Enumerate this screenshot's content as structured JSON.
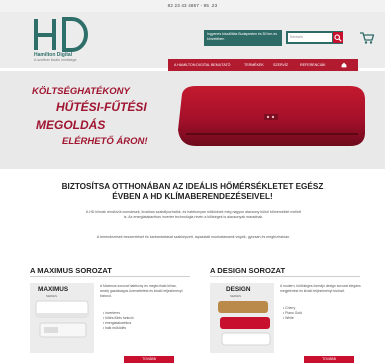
{
  "topbar": {
    "phone": "82 23 43 4867 - 85 .23"
  },
  "logo": {
    "mark": "HD",
    "name": "Hamilton Digital",
    "tagline": "A szoftver kiváló minősége"
  },
  "promo": {
    "text": "Ingyenes kiszállítás Budapesten és 50 km-es körzetében"
  },
  "search": {
    "placeholder": "Keresés"
  },
  "nav": {
    "items": [
      "A HAMILTON DIGITAL BEMUTATÓ",
      "TERMÉKEK",
      "SZERVÍZ",
      "REFERENCIÁK"
    ]
  },
  "banner": {
    "line1": "Költséghatékony",
    "line2": "hűtési-fűtési",
    "line3": "megoldás",
    "line4": "elérhető áron!"
  },
  "intro": {
    "heading": "Biztosítsa otthonában az ideális hőmérsékletet egész évben a HD klímaberendezéseivel!",
    "para1": "A HD klímák rendkívül csendesek, kiválóan szabályozhatók, és hatékonyan működnek még nagyon alacsony külső hőmérséklet mellett is. Az energiatakarékos inverter technológia révén a költségek is alacsonyak maradnak.",
    "para2": "A berendezések beszerelését és karbantartását szakképzett, tapasztalt munkatársaink végzik, gyorsan és megbízhatóan."
  },
  "series": [
    {
      "title": "A Maximus sorozat",
      "brand": "MAXIMUS",
      "brand_sub": "SERIES",
      "desc": "A Maximus sorozat hatékony és megbízható klíma, amely gazdaságos üzemeltetést és kiváló teljesítményt biztosít.",
      "features": [
        "• inverteres",
        "• hűtés-fűtés funkció",
        "• energiatakarékos",
        "• halk működés"
      ],
      "button": "TOVÁBB"
    },
    {
      "title": "A Design sorozat",
      "brand": "DESIGN",
      "brand_sub": "SERIES",
      "desc": "A modern, különleges formájú design sorozat elegáns megjelenést és kiváló teljesítményt biztosít.",
      "features": [
        "• Cherry",
        "• Piano Gold",
        "• White"
      ],
      "button": "TOVÁBB"
    }
  ],
  "colors": {
    "accent": "#c8102e",
    "teal": "#2e6b66",
    "nav": "#b21b2f"
  }
}
